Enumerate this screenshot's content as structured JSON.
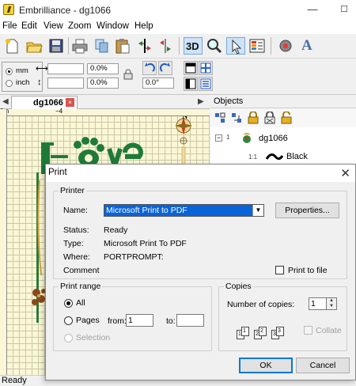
{
  "app": {
    "name": "Embrilliance",
    "document": "dg1066"
  },
  "window_controls": {
    "minimize": "—",
    "maximize": "☐"
  },
  "menu": [
    "File",
    "Edit",
    "View",
    "Zoom",
    "Window",
    "Help"
  ],
  "toolbar": {
    "buttons": [
      "new-icon",
      "open-icon",
      "save-icon",
      "print-icon",
      "copy-icon",
      "paste-icon",
      "mirror-horizontal-icon",
      "mirror-vertical-icon",
      "3d-toggle",
      "zoom-icon",
      "select-icon",
      "thread-chart-icon",
      "settings-icon",
      "lettering-icon"
    ],
    "three_d_label": "3D",
    "lettering_label": "A"
  },
  "properties": {
    "units": {
      "mm": "mm",
      "inch": "inch",
      "selected": "mm"
    },
    "width": "",
    "height": "",
    "width_pct": "0.0%",
    "height_pct": "0.0%",
    "rotation": "0.0°"
  },
  "document_tab": {
    "label": "dg1066",
    "close": "×"
  },
  "objects_panel": {
    "title": "Objects",
    "tree": {
      "root_toggle": "−",
      "root_index": "1",
      "root_label": "dg1066",
      "child_index": "1:1",
      "child_label": "Black"
    }
  },
  "canvas": {
    "ruler_origin": "0m",
    "ruler_mark": "−4",
    "compass_label": "N"
  },
  "status": "Ready",
  "print_dialog": {
    "title": "Print",
    "close": "✕",
    "printer": {
      "legend": "Printer",
      "name_label": "Name:",
      "name_value": "Microsoft Print to PDF",
      "properties_button": "Properties...",
      "status_label": "Status:",
      "status_value": "Ready",
      "type_label": "Type:",
      "type_value": "Microsoft Print To PDF",
      "where_label": "Where:",
      "where_value": "PORTPROMPT:",
      "comment_label": "Comment",
      "print_to_file": "Print to file"
    },
    "print_range": {
      "legend": "Print range",
      "all": "All",
      "pages": "Pages",
      "from_label": "from:",
      "from_value": "1",
      "to_label": "to:",
      "to_value": "",
      "selection": "Selection",
      "selected": "All"
    },
    "copies": {
      "legend": "Copies",
      "number_label": "Number of copies:",
      "number_value": "1",
      "collate": "Collate",
      "collate_pages": [
        "1",
        "1",
        "2",
        "2",
        "3",
        "3"
      ]
    },
    "ok_button": "OK",
    "cancel_button": "Cancel"
  },
  "colors": {
    "selection_blue": "#0a64d8",
    "canvas_bg": "#fbf7d6",
    "love_green": "#1f7a3a",
    "close_red": "#d9534f"
  }
}
